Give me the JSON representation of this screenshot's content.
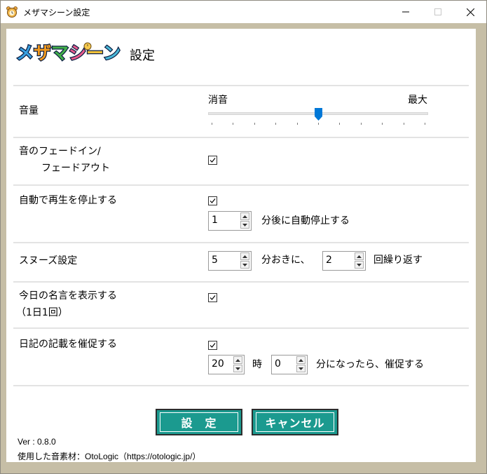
{
  "window": {
    "title": "メザマシーン設定",
    "icon": "alarm-clock-bear-icon"
  },
  "header": {
    "logo_text": "メザマシーン",
    "title": "設定"
  },
  "volume": {
    "label": "音量",
    "min_label": "消音",
    "max_label": "最大",
    "level_fraction": 0.5
  },
  "fade": {
    "label_line1": "音のフェードイン/",
    "label_line2": "フェードアウト",
    "checked": true
  },
  "auto_stop": {
    "label": "自動で再生を停止する",
    "checked": true,
    "minutes_value": "1",
    "suffix": "分後に自動停止する"
  },
  "snooze": {
    "label": "スヌーズ設定",
    "interval_value": "5",
    "interval_suffix": "分おきに、",
    "repeat_value": "2",
    "repeat_suffix": "回繰り返す"
  },
  "quote": {
    "label_line1": "今日の名言を表示する",
    "label_line2": "（1日1回）",
    "checked": true
  },
  "diary": {
    "label": "日記の記載を催促する",
    "checked": true,
    "hour_value": "20",
    "hour_suffix": "時",
    "minute_value": "0",
    "minute_suffix": "分になったら、催促する"
  },
  "buttons": {
    "ok_label": "設　定",
    "cancel_label": "キャンセル",
    "accent_color": "#1b9a8f"
  },
  "footer": {
    "version": "Ver : 0.8.0",
    "credit": "使用した音素材：OtoLogic（https://otologic.jp/）"
  }
}
